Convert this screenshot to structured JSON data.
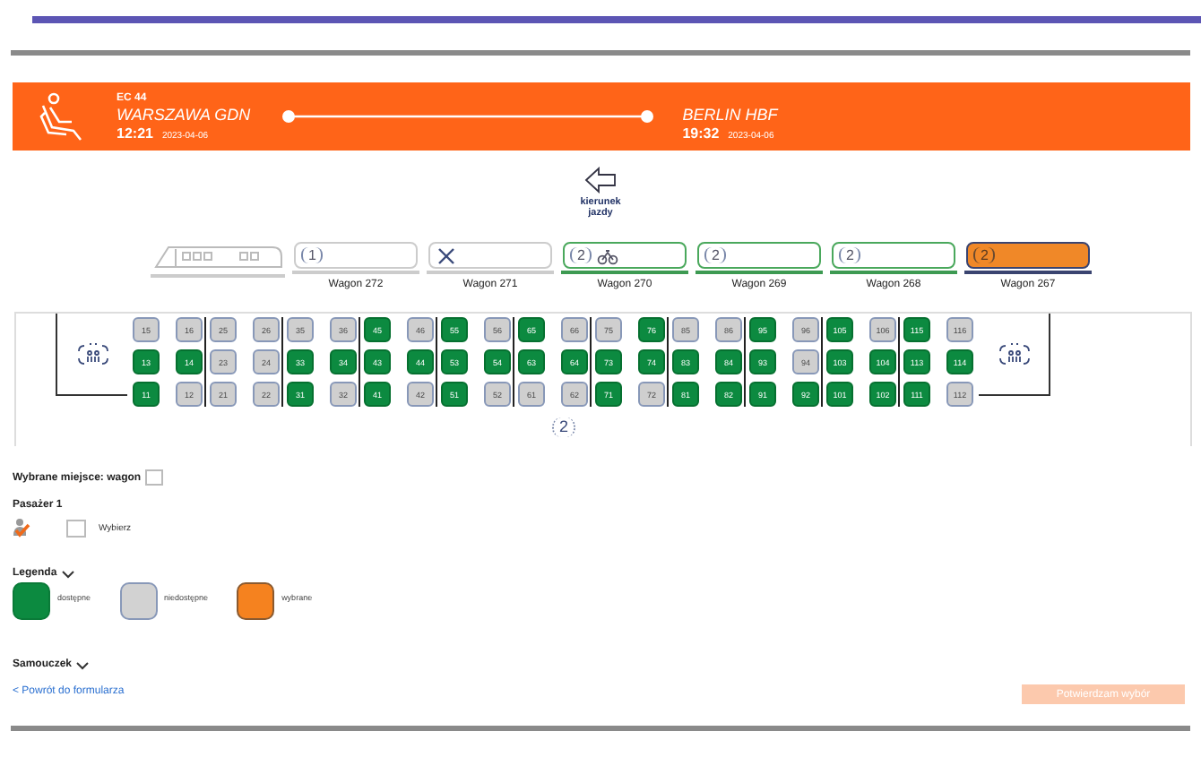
{
  "journey": {
    "train": "EC 44",
    "from": "WARSZAWA GDN",
    "departure_time": "12:21",
    "departure_date": "2023-04-06",
    "to": "BERLIN HBF",
    "arrival_time": "19:32",
    "arrival_date": "2023-04-06"
  },
  "direction": {
    "label": "kierunek jazdy"
  },
  "wagons": [
    {
      "kind": "locomotive"
    },
    {
      "kind": "class",
      "label": "Wagon 272",
      "class": "1",
      "selected": false,
      "available": false
    },
    {
      "kind": "restaurant",
      "label": "Wagon 271",
      "selected": false,
      "available": false
    },
    {
      "kind": "class_bike",
      "label": "Wagon 270",
      "class": "2",
      "selected": false,
      "available": true
    },
    {
      "kind": "class",
      "label": "Wagon 269",
      "class": "2",
      "selected": false,
      "available": true
    },
    {
      "kind": "class",
      "label": "Wagon 268",
      "class": "2",
      "selected": false,
      "available": true
    },
    {
      "kind": "class",
      "label": "Wagon 267",
      "class": "2",
      "selected": true,
      "available": false
    }
  ],
  "seat_map": {
    "class_marker": "2",
    "seat_groups": [
      {
        "columns": [
          {
            "seats": [
              {
                "number": "15",
                "available": false
              },
              {
                "number": "13",
                "available": true
              },
              {
                "number": "11",
                "available": true
              }
            ]
          }
        ]
      },
      {
        "columns": [
          {
            "seats": [
              {
                "number": "16",
                "available": false
              },
              {
                "number": "14",
                "available": true
              },
              {
                "number": "12",
                "available": false
              }
            ]
          },
          {
            "seats": [
              {
                "number": "25",
                "available": false
              },
              {
                "number": "23",
                "available": false
              },
              {
                "number": "21",
                "available": false
              }
            ]
          }
        ]
      },
      {
        "columns": [
          {
            "seats": [
              {
                "number": "26",
                "available": false
              },
              {
                "number": "24",
                "available": false
              },
              {
                "number": "22",
                "available": false
              }
            ]
          },
          {
            "seats": [
              {
                "number": "35",
                "available": false
              },
              {
                "number": "33",
                "available": true
              },
              {
                "number": "31",
                "available": true
              }
            ]
          }
        ]
      },
      {
        "columns": [
          {
            "seats": [
              {
                "number": "36",
                "available": false
              },
              {
                "number": "34",
                "available": true
              },
              {
                "number": "32",
                "available": false
              }
            ]
          },
          {
            "seats": [
              {
                "number": "45",
                "available": true
              },
              {
                "number": "43",
                "available": true
              },
              {
                "number": "41",
                "available": true
              }
            ]
          }
        ]
      },
      {
        "columns": [
          {
            "seats": [
              {
                "number": "46",
                "available": false
              },
              {
                "number": "44",
                "available": true
              },
              {
                "number": "42",
                "available": false
              }
            ]
          },
          {
            "seats": [
              {
                "number": "55",
                "available": true
              },
              {
                "number": "53",
                "available": true
              },
              {
                "number": "51",
                "available": true
              }
            ]
          }
        ]
      },
      {
        "columns": [
          {
            "seats": [
              {
                "number": "56",
                "available": false
              },
              {
                "number": "54",
                "available": true
              },
              {
                "number": "52",
                "available": false
              }
            ]
          },
          {
            "seats": [
              {
                "number": "65",
                "available": true
              },
              {
                "number": "63",
                "available": true
              },
              {
                "number": "61",
                "available": false
              }
            ]
          }
        ]
      },
      {
        "columns": [
          {
            "seats": [
              {
                "number": "66",
                "available": false
              },
              {
                "number": "64",
                "available": true
              },
              {
                "number": "62",
                "available": false
              }
            ]
          },
          {
            "seats": [
              {
                "number": "75",
                "available": false
              },
              {
                "number": "73",
                "available": true
              },
              {
                "number": "71",
                "available": true
              }
            ]
          }
        ]
      },
      {
        "columns": [
          {
            "seats": [
              {
                "number": "76",
                "available": true
              },
              {
                "number": "74",
                "available": true
              },
              {
                "number": "72",
                "available": false
              }
            ]
          },
          {
            "seats": [
              {
                "number": "85",
                "available": false
              },
              {
                "number": "83",
                "available": true
              },
              {
                "number": "81",
                "available": true
              }
            ]
          }
        ]
      },
      {
        "columns": [
          {
            "seats": [
              {
                "number": "86",
                "available": false
              },
              {
                "number": "84",
                "available": true
              },
              {
                "number": "82",
                "available": true
              }
            ]
          },
          {
            "seats": [
              {
                "number": "95",
                "available": true
              },
              {
                "number": "93",
                "available": true
              },
              {
                "number": "91",
                "available": true
              }
            ]
          }
        ]
      },
      {
        "columns": [
          {
            "seats": [
              {
                "number": "96",
                "available": false
              },
              {
                "number": "94",
                "available": false
              },
              {
                "number": "92",
                "available": true
              }
            ]
          },
          {
            "seats": [
              {
                "number": "105",
                "available": true
              },
              {
                "number": "103",
                "available": true
              },
              {
                "number": "101",
                "available": true
              }
            ]
          }
        ]
      },
      {
        "columns": [
          {
            "seats": [
              {
                "number": "106",
                "available": false
              },
              {
                "number": "104",
                "available": true
              },
              {
                "number": "102",
                "available": true
              }
            ]
          },
          {
            "seats": [
              {
                "number": "115",
                "available": true
              },
              {
                "number": "113",
                "available": true
              },
              {
                "number": "111",
                "available": true
              }
            ]
          }
        ]
      },
      {
        "columns": [
          {
            "seats": [
              {
                "number": "116",
                "available": false
              },
              {
                "number": "114",
                "available": true
              },
              {
                "number": "112",
                "available": false
              }
            ]
          }
        ]
      }
    ]
  },
  "selection": {
    "label": "Wybrane miejsce: wagon",
    "passenger": "Pasażer 1",
    "choose": "Wybierz",
    "checked": false
  },
  "legend": {
    "title": "Legenda",
    "expanded": true,
    "items": [
      {
        "kind": "available",
        "label": "dostępne"
      },
      {
        "kind": "unavailable",
        "label": "niedostępne"
      },
      {
        "kind": "selected",
        "label": "wybrane"
      }
    ]
  },
  "tutorial": {
    "title": "Samouczek"
  },
  "back_link": "< Powrót do formularza",
  "confirm_button": {
    "label": "Potwierdzam wybór",
    "disabled": true
  }
}
